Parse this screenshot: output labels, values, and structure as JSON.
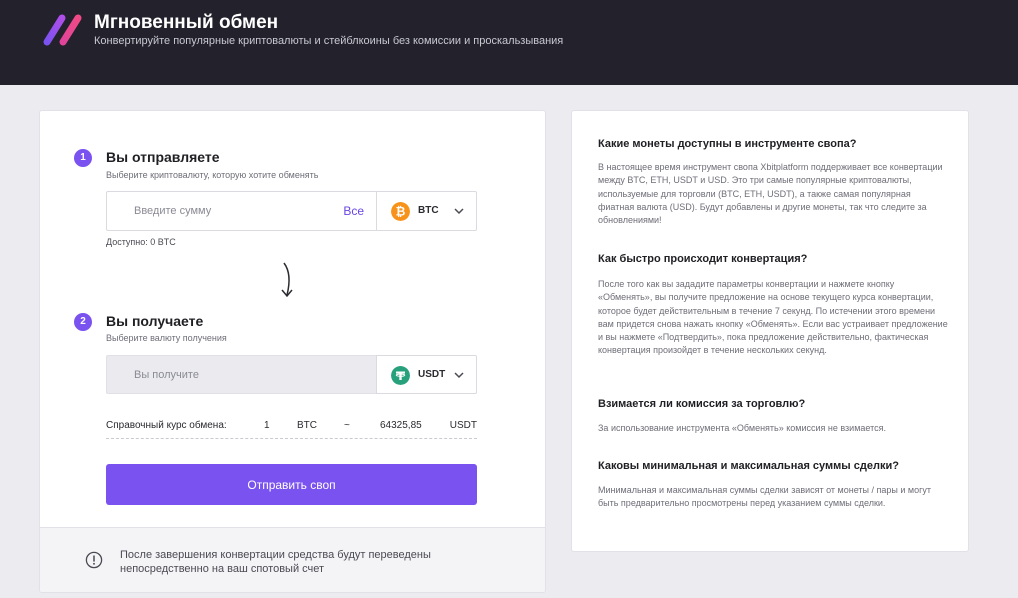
{
  "header": {
    "title": "Мгновенный обмен",
    "subtitle": "Конвертируйте популярные криптовалюты и стейблкоины без комиссии и проскальзывания"
  },
  "colors": {
    "accent": "#7a52f0",
    "header_bg": "#22212c",
    "btc": "#f7931a",
    "usdt": "#26a17b"
  },
  "send": {
    "step": "1",
    "title": "Вы отправляете",
    "hint": "Выберите криптовалюту, которую хотите обменять",
    "input_value": "",
    "input_placeholder": "Введите сумму",
    "all_label": "Все",
    "coin": "BTC",
    "coin_icon": "bitcoin-icon",
    "available": "Доступно: 0 BTC"
  },
  "receive": {
    "step": "2",
    "title": "Вы получаете",
    "hint": "Выберите валюту получения",
    "input_value": "",
    "input_placeholder": "Вы получите",
    "coin": "USDT",
    "coin_icon": "tether-icon"
  },
  "rate": {
    "label": "Справочный курс обмена:",
    "amount": "1",
    "from": "BTC",
    "approx": "~",
    "value": "64325,85",
    "to": "USDT"
  },
  "submit_label": "Отправить своп",
  "footer_note": "После завершения конвертации средства будут переведены непосредственно на ваш спотовый счет",
  "faq": [
    {
      "q": "Какие монеты доступны в инструменте свопа?",
      "a": "В настоящее время инструмент свопа Xbitplatform поддерживает все конвертации между BTC, ETH, USDT и USD. Это три самые популярные криптовалюты, используемые для торговли (BTC, ETH, USDT), а также самая популярная фиатная валюта (USD). Будут добавлены и другие монеты, так что следите за обновлениями!"
    },
    {
      "q": "Как быстро происходит конвертация?",
      "a": "После того как вы зададите параметры конвертации и нажмете кнопку «Обменять», вы получите предложение на основе текущего курса конвертации, которое будет действительным в течение 7 секунд. По истечении этого времени вам придется снова нажать кнопку «Обменять». Если вас устраивает предложение и вы нажмете «Подтвердить», пока предложение действительно, фактическая конвертация произойдет в течение нескольких секунд."
    },
    {
      "q": "Взимается ли комиссия за торговлю?",
      "a": "За использование инструмента «Обменять» комиссия не взимается."
    },
    {
      "q": "Каковы минимальная и максимальная суммы сделки?",
      "a": "Минимальная и максимальная суммы сделки зависят от монеты / пары и могут быть предварительно просмотрены перед указанием суммы сделки."
    }
  ]
}
